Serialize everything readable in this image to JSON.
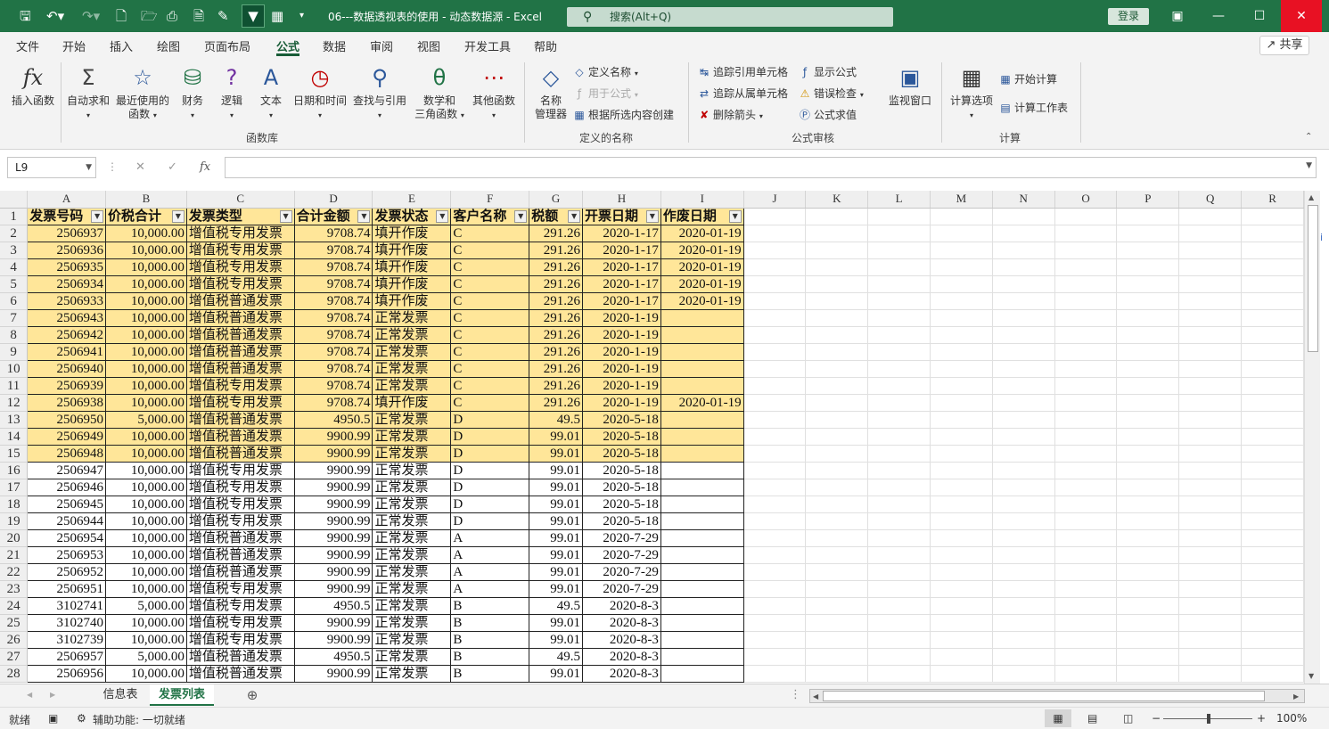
{
  "titlebar": {
    "doc_title": "06---数据透视表的使用 - 动态数据源  -  Excel",
    "search_placeholder": "搜索(Alt+Q)",
    "login": "登录"
  },
  "menu": {
    "tabs": [
      "文件",
      "开始",
      "插入",
      "绘图",
      "页面布局",
      "公式",
      "数据",
      "审阅",
      "视图",
      "开发工具",
      "帮助"
    ],
    "active": "公式",
    "share": "共享"
  },
  "ribbon": {
    "insert_fn": "插入函数",
    "autosum": "自动求和",
    "recent": [
      "最近使用的",
      "函数"
    ],
    "finance": "财务",
    "logic": "逻辑",
    "text": "文本",
    "datetime": "日期和时间",
    "lookup": "查找与引用",
    "mathtrig": [
      "数学和",
      "三角函数"
    ],
    "more": "其他函数",
    "group_library": "函数库",
    "name_mgr": [
      "名称",
      "管理器"
    ],
    "define_name": "定义名称",
    "use_in_formula": "用于公式",
    "create_from_sel": "根据所选内容创建",
    "group_names": "定义的名称",
    "trace_prec": "追踪引用单元格",
    "trace_dep": "追踪从属单元格",
    "remove_arrows": "删除箭头",
    "show_formulas": "显示公式",
    "error_check": "错误检查",
    "eval_formula": "公式求值",
    "group_audit": "公式审核",
    "watch": "监视窗口",
    "calc_options": "计算选项",
    "calc_now": "开始计算",
    "calc_sheet": "计算工作表",
    "group_calc": "计算"
  },
  "formula_bar": {
    "cell_ref": "L9",
    "formula": ""
  },
  "columns": [
    "A",
    "B",
    "C",
    "D",
    "E",
    "F",
    "G",
    "H",
    "I",
    "J",
    "K",
    "L",
    "M",
    "N",
    "O",
    "P",
    "Q",
    "R"
  ],
  "headers": [
    "发票号码",
    "价税合计",
    "发票类型",
    "合计金额",
    "发票状态",
    "客户名称",
    "税额",
    "开票日期",
    "作废日期"
  ],
  "rows": [
    [
      "2506937",
      "10,000.00",
      "增值税专用发票",
      "9708.74",
      "填开作废",
      "C",
      "291.26",
      "2020-1-17",
      "2020-01-19"
    ],
    [
      "2506936",
      "10,000.00",
      "增值税专用发票",
      "9708.74",
      "填开作废",
      "C",
      "291.26",
      "2020-1-17",
      "2020-01-19"
    ],
    [
      "2506935",
      "10,000.00",
      "增值税专用发票",
      "9708.74",
      "填开作废",
      "C",
      "291.26",
      "2020-1-17",
      "2020-01-19"
    ],
    [
      "2506934",
      "10,000.00",
      "增值税专用发票",
      "9708.74",
      "填开作废",
      "C",
      "291.26",
      "2020-1-17",
      "2020-01-19"
    ],
    [
      "2506933",
      "10,000.00",
      "增值税普通发票",
      "9708.74",
      "填开作废",
      "C",
      "291.26",
      "2020-1-17",
      "2020-01-19"
    ],
    [
      "2506943",
      "10,000.00",
      "增值税普通发票",
      "9708.74",
      "正常发票",
      "C",
      "291.26",
      "2020-1-19",
      ""
    ],
    [
      "2506942",
      "10,000.00",
      "增值税普通发票",
      "9708.74",
      "正常发票",
      "C",
      "291.26",
      "2020-1-19",
      ""
    ],
    [
      "2506941",
      "10,000.00",
      "增值税普通发票",
      "9708.74",
      "正常发票",
      "C",
      "291.26",
      "2020-1-19",
      ""
    ],
    [
      "2506940",
      "10,000.00",
      "增值税普通发票",
      "9708.74",
      "正常发票",
      "C",
      "291.26",
      "2020-1-19",
      ""
    ],
    [
      "2506939",
      "10,000.00",
      "增值税专用发票",
      "9708.74",
      "正常发票",
      "C",
      "291.26",
      "2020-1-19",
      ""
    ],
    [
      "2506938",
      "10,000.00",
      "增值税专用发票",
      "9708.74",
      "填开作废",
      "C",
      "291.26",
      "2020-1-19",
      "2020-01-19"
    ],
    [
      "2506950",
      "5,000.00",
      "增值税普通发票",
      "4950.5",
      "正常发票",
      "D",
      "49.5",
      "2020-5-18",
      ""
    ],
    [
      "2506949",
      "10,000.00",
      "增值税普通发票",
      "9900.99",
      "正常发票",
      "D",
      "99.01",
      "2020-5-18",
      ""
    ],
    [
      "2506948",
      "10,000.00",
      "增值税普通发票",
      "9900.99",
      "正常发票",
      "D",
      "99.01",
      "2020-5-18",
      ""
    ],
    [
      "2506947",
      "10,000.00",
      "增值税专用发票",
      "9900.99",
      "正常发票",
      "D",
      "99.01",
      "2020-5-18",
      ""
    ],
    [
      "2506946",
      "10,000.00",
      "增值税专用发票",
      "9900.99",
      "正常发票",
      "D",
      "99.01",
      "2020-5-18",
      ""
    ],
    [
      "2506945",
      "10,000.00",
      "增值税专用发票",
      "9900.99",
      "正常发票",
      "D",
      "99.01",
      "2020-5-18",
      ""
    ],
    [
      "2506944",
      "10,000.00",
      "增值税专用发票",
      "9900.99",
      "正常发票",
      "D",
      "99.01",
      "2020-5-18",
      ""
    ],
    [
      "2506954",
      "10,000.00",
      "增值税普通发票",
      "9900.99",
      "正常发票",
      "A",
      "99.01",
      "2020-7-29",
      ""
    ],
    [
      "2506953",
      "10,000.00",
      "增值税普通发票",
      "9900.99",
      "正常发票",
      "A",
      "99.01",
      "2020-7-29",
      ""
    ],
    [
      "2506952",
      "10,000.00",
      "增值税普通发票",
      "9900.99",
      "正常发票",
      "A",
      "99.01",
      "2020-7-29",
      ""
    ],
    [
      "2506951",
      "10,000.00",
      "增值税专用发票",
      "9900.99",
      "正常发票",
      "A",
      "99.01",
      "2020-7-29",
      ""
    ],
    [
      "3102741",
      "5,000.00",
      "增值税专用发票",
      "4950.5",
      "正常发票",
      "B",
      "49.5",
      "2020-8-3",
      ""
    ],
    [
      "3102740",
      "10,000.00",
      "增值税专用发票",
      "9900.99",
      "正常发票",
      "B",
      "99.01",
      "2020-8-3",
      ""
    ],
    [
      "3102739",
      "10,000.00",
      "增值税专用发票",
      "9900.99",
      "正常发票",
      "B",
      "99.01",
      "2020-8-3",
      ""
    ],
    [
      "2506957",
      "5,000.00",
      "增值税普通发票",
      "4950.5",
      "正常发票",
      "B",
      "49.5",
      "2020-8-3",
      ""
    ],
    [
      "2506956",
      "10,000.00",
      "增值税普通发票",
      "9900.99",
      "正常发票",
      "B",
      "99.01",
      "2020-8-3",
      ""
    ]
  ],
  "highlight_rows": 14,
  "sheets": [
    "信息表",
    "发票列表"
  ],
  "active_sheet": "发票列表",
  "status": {
    "ready": "就绪",
    "accessibility": "辅助功能: 一切就绪",
    "zoom": "100%"
  },
  "colors": {
    "accent": "#217346",
    "highlight": "#ffe699",
    "close": "#e81123"
  }
}
